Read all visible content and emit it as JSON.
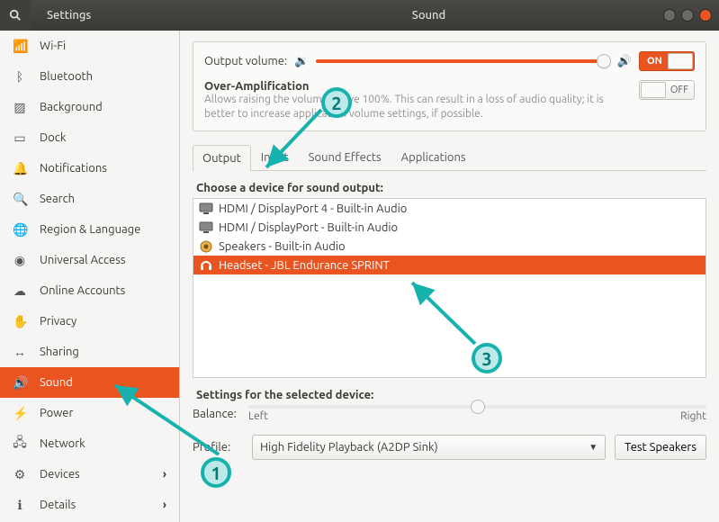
{
  "window": {
    "app_title": "Settings",
    "panel_title": "Sound"
  },
  "sidebar": {
    "items": [
      {
        "label": "Wi-Fi",
        "icon": "📶"
      },
      {
        "label": "Bluetooth",
        "icon": "ᛒ"
      },
      {
        "label": "Background",
        "icon": "▨"
      },
      {
        "label": "Dock",
        "icon": "▭"
      },
      {
        "label": "Notifications",
        "icon": "🔔"
      },
      {
        "label": "Search",
        "icon": "🔍"
      },
      {
        "label": "Region & Language",
        "icon": "🌐"
      },
      {
        "label": "Universal Access",
        "icon": "◉"
      },
      {
        "label": "Online Accounts",
        "icon": "☁"
      },
      {
        "label": "Privacy",
        "icon": "✋"
      },
      {
        "label": "Sharing",
        "icon": "↔"
      },
      {
        "label": "Sound",
        "icon": "🔊",
        "selected": true
      },
      {
        "label": "Power",
        "icon": "⚡"
      },
      {
        "label": "Network",
        "icon": "🖧"
      },
      {
        "label": "Devices",
        "icon": "⚙",
        "arrow": true
      },
      {
        "label": "Details",
        "icon": "ℹ",
        "arrow": true
      }
    ]
  },
  "output_volume": {
    "label": "Output volume:",
    "percent": 98,
    "toggle_label": "ON"
  },
  "overamp": {
    "title": "Over-Amplification",
    "desc": "Allows raising the volume above 100%. This can result in a loss of audio quality; it is better to increase application volume settings, if possible.",
    "toggle_label": "OFF"
  },
  "tabs": [
    {
      "label": "Output",
      "active": true
    },
    {
      "label": "Input"
    },
    {
      "label": "Sound Effects"
    },
    {
      "label": "Applications"
    }
  ],
  "device_section": {
    "title": "Choose a device for sound output:",
    "items": [
      {
        "label": "HDMI / DisplayPort 4 - Built-in Audio",
        "icon": "monitor"
      },
      {
        "label": "HDMI / DisplayPort - Built-in Audio",
        "icon": "monitor"
      },
      {
        "label": "Speakers - Built-in Audio",
        "icon": "speaker"
      },
      {
        "label": "Headset - JBL Endurance SPRINT",
        "icon": "headset",
        "selected": true
      }
    ]
  },
  "selected_settings": {
    "title": "Settings for the selected device:",
    "balance_label": "Balance:",
    "left_label": "Left",
    "right_label": "Right",
    "profile_label": "Profile:",
    "profile_value": "High Fidelity Playback (A2DP Sink)",
    "test_button": "Test Speakers"
  },
  "annotations": {
    "one": "1",
    "two": "2",
    "three": "3"
  }
}
